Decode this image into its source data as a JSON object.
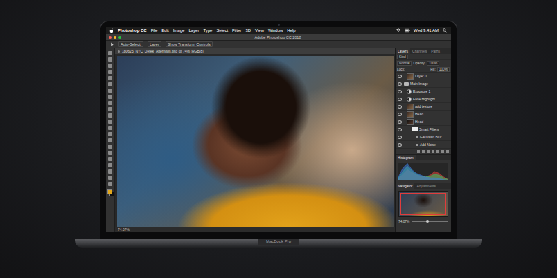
{
  "device": {
    "label": "MacBook Pro"
  },
  "menu_bar": {
    "app": "Photoshop CC",
    "items": [
      "File",
      "Edit",
      "Image",
      "Layer",
      "Type",
      "Select",
      "Filter",
      "3D",
      "View",
      "Window",
      "Help"
    ],
    "clock": "Wed 9:41 AM"
  },
  "window": {
    "title": "Adobe Photoshop CC 2018"
  },
  "options_bar": {
    "items": [
      "Auto-Select:",
      "Layer",
      "Show Transform Controls"
    ]
  },
  "document": {
    "tab": "180625_NYC_Derek_Afternoon.psd @ 74% (RGB/8)",
    "zoom": "74.07%"
  },
  "layers_panel": {
    "tabs": [
      {
        "label": "Layers",
        "selected": true
      },
      {
        "label": "Channels",
        "selected": false
      },
      {
        "label": "Paths",
        "selected": false
      }
    ],
    "filter": "Kind",
    "blend_mode": "Normal",
    "opacity_label": "Opacity:",
    "opacity": "100%",
    "lock_label": "Lock:",
    "fill_label": "Fill:",
    "fill": "100%",
    "layers": [
      {
        "name": "Layer 0",
        "kind": "layer",
        "visible": true,
        "selected": false
      },
      {
        "name": "Main Image",
        "kind": "group",
        "visible": true,
        "selected": false
      },
      {
        "name": "Exposure 1",
        "kind": "adjustment",
        "visible": true,
        "selected": false
      },
      {
        "name": "Face Highlight",
        "kind": "adjustment",
        "visible": true,
        "selected": false
      },
      {
        "name": "add texture",
        "kind": "layer",
        "visible": true,
        "selected": false
      },
      {
        "name": "Head",
        "kind": "layer",
        "visible": true,
        "selected": false
      },
      {
        "name": "Head",
        "kind": "smart-object",
        "visible": true,
        "selected": false
      },
      {
        "name": "Smart Filters",
        "kind": "filters",
        "visible": true,
        "selected": false
      },
      {
        "name": "Gaussian Blur",
        "kind": "filter",
        "visible": true,
        "selected": false
      },
      {
        "name": "Add Noise",
        "kind": "filter",
        "visible": true,
        "selected": false
      }
    ]
  },
  "histogram_panel": {
    "title": "Histogram",
    "series": [
      {
        "name": "red",
        "color": "#e0413c",
        "values": [
          0.1,
          0.35,
          0.6,
          0.45,
          0.3,
          0.25,
          0.2,
          0.3,
          0.5,
          0.4,
          0.2,
          0.05
        ]
      },
      {
        "name": "green",
        "color": "#3cc46a",
        "values": [
          0.15,
          0.5,
          0.8,
          0.55,
          0.35,
          0.25,
          0.2,
          0.25,
          0.35,
          0.3,
          0.15,
          0.05
        ]
      },
      {
        "name": "blue",
        "color": "#3c7de0",
        "values": [
          0.2,
          0.7,
          0.95,
          0.6,
          0.4,
          0.3,
          0.2,
          0.15,
          0.15,
          0.1,
          0.05,
          0.02
        ]
      }
    ]
  },
  "navigator_panel": {
    "tabs": [
      {
        "label": "Navigator",
        "selected": true
      },
      {
        "label": "Adjustments",
        "selected": false
      }
    ],
    "zoom": "74.07%"
  }
}
